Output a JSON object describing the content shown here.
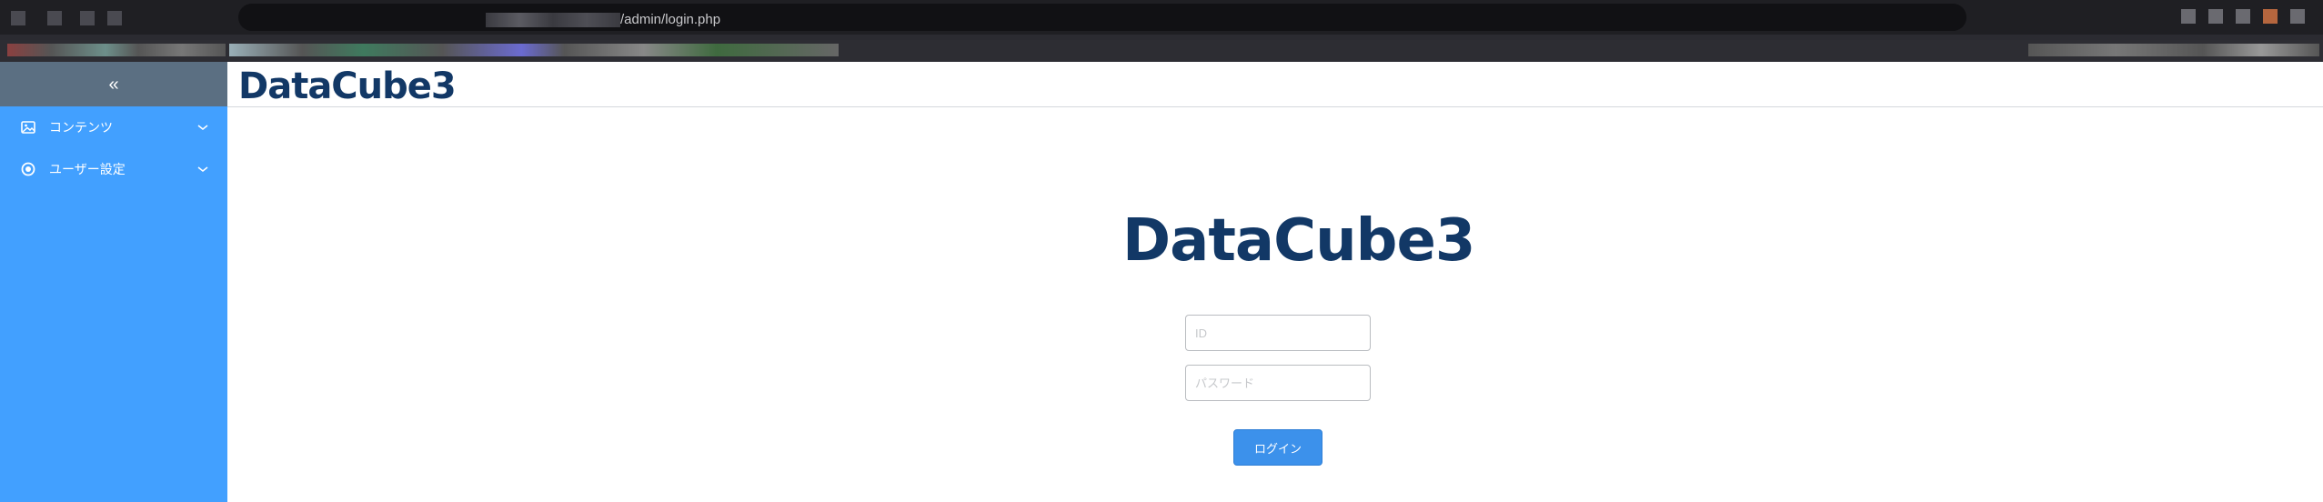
{
  "browser": {
    "url": "/admin/login.php"
  },
  "sidebar": {
    "collapse_glyph": "«",
    "items": [
      {
        "label": "コンテンツ",
        "icon": "image-icon",
        "chevron": "chevron-down-icon"
      },
      {
        "label": "ユーザー設定",
        "icon": "settings-icon",
        "chevron": "chevron-down-icon"
      }
    ]
  },
  "header": {
    "logo": "DataCube3"
  },
  "login": {
    "logo": "DataCube3",
    "id_placeholder": "ID",
    "password_placeholder": "パスワード",
    "submit_label": "ログイン"
  },
  "colors": {
    "sidebar": "#42a0ff",
    "sidebar_header": "#5b6f82",
    "logo": "#123866",
    "button": "#3c91eb"
  }
}
